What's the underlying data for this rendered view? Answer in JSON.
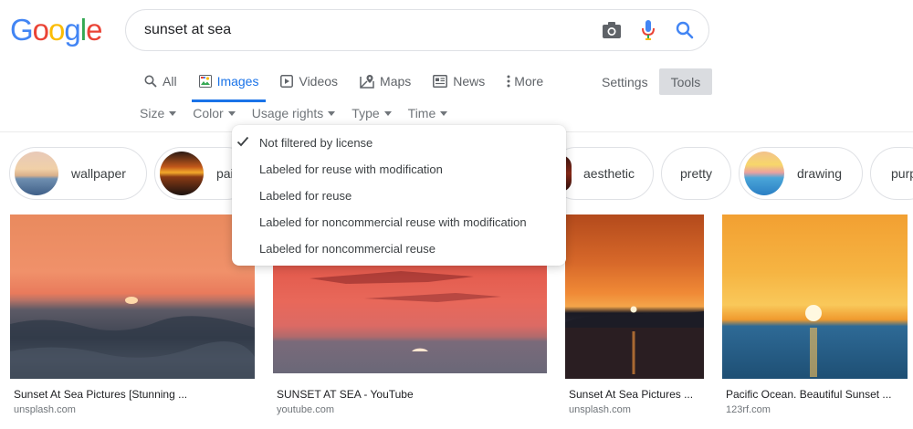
{
  "logo": {
    "letters": [
      "G",
      "o",
      "o",
      "g",
      "l",
      "e"
    ],
    "colors": [
      "#4285F4",
      "#EA4335",
      "#FBBC05",
      "#4285F4",
      "#34A853",
      "#EA4335"
    ]
  },
  "search": {
    "query": "sunset at sea",
    "icons": [
      "camera-icon",
      "microphone-icon",
      "search-icon"
    ]
  },
  "tabs": [
    {
      "label": "All",
      "icon": "search-icon",
      "active": false
    },
    {
      "label": "Images",
      "icon": "image-icon",
      "active": true
    },
    {
      "label": "Videos",
      "icon": "video-icon",
      "active": false
    },
    {
      "label": "Maps",
      "icon": "map-icon",
      "active": false
    },
    {
      "label": "News",
      "icon": "news-icon",
      "active": false
    },
    {
      "label": "More",
      "icon": "more-dots-icon",
      "active": false
    }
  ],
  "settings_label": "Settings",
  "tools_label": "Tools",
  "filters": [
    "Size",
    "Color",
    "Usage rights",
    "Type",
    "Time"
  ],
  "chips": [
    "wallpaper",
    "pai",
    "aesthetic",
    "pretty",
    "drawing",
    "purp"
  ],
  "usage_menu": {
    "items": [
      {
        "label": "Not filtered by license",
        "checked": true
      },
      {
        "label": "Labeled for reuse with modification",
        "checked": false
      },
      {
        "label": "Labeled for reuse",
        "checked": false
      },
      {
        "label": "Labeled for noncommercial reuse with modification",
        "checked": false
      },
      {
        "label": "Labeled for noncommercial reuse",
        "checked": false
      }
    ]
  },
  "results": [
    {
      "title": "Sunset At Sea Pictures [Stunning ...",
      "domain": "unsplash.com"
    },
    {
      "title": "SUNSET AT SEA - YouTube",
      "domain": "youtube.com"
    },
    {
      "title": "Sunset At Sea Pictures ...",
      "domain": "unsplash.com"
    },
    {
      "title": "Pacific Ocean. Beautiful Sunset ...",
      "domain": "123rf.com"
    }
  ],
  "colors": {
    "accent": "#1a73e8",
    "tools_bg": "#dadce0"
  }
}
